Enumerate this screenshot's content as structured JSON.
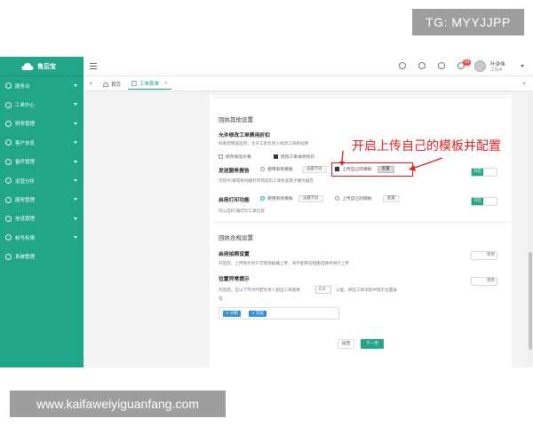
{
  "watermark": {
    "tg": "TG: MYYJJPP",
    "site": "www.kaifaweiyiguanfang.com"
  },
  "app": {
    "brand": "售后宝",
    "nav_items": [
      {
        "label": "服务台",
        "icon": "home-icon"
      },
      {
        "label": "工单中心",
        "icon": "ticket-icon"
      },
      {
        "label": "财务管理",
        "icon": "finance-icon"
      },
      {
        "label": "客户信息",
        "icon": "customer-icon"
      },
      {
        "label": "备件管理",
        "icon": "parts-icon"
      },
      {
        "label": "运营分析",
        "icon": "analytics-icon"
      },
      {
        "label": "服务管理",
        "icon": "service-icon"
      },
      {
        "label": "信息管理",
        "icon": "info-icon"
      },
      {
        "label": "帐号权限",
        "icon": "account-icon"
      },
      {
        "label": "系统管理",
        "icon": "system-icon"
      }
    ]
  },
  "topbar": {
    "badge": "10",
    "user_name": "叶泽伟",
    "user_status": "工作中"
  },
  "tabs": {
    "home": "首页",
    "work_order": "工单套单",
    "close": "×",
    "prev": "«",
    "next": "»"
  },
  "section1": {
    "title": "回执其他设置",
    "allow_discount": {
      "label": "允许修改工单费用折扣",
      "desc": "如果启用该选项，允许工单负责人修改工单折扣费",
      "opt1": "修改单品价格",
      "opt2": "修改工单总折扣价"
    },
    "send_report": {
      "label": "发送服务报告",
      "opt_system": "使用系统模板",
      "btn_set_field": "设置字段",
      "opt_own": "上传自己的模板",
      "btn_config": "配置",
      "desc": "可在PC端或移动端打印完成的工单生成电子服务报告",
      "toggle": "开启"
    },
    "print": {
      "label": "启用打印功能",
      "opt_system": "使用系统模板",
      "btn_set_field": "设置字段",
      "opt_own": "上传自己的模板",
      "btn_config": "配置",
      "desc": "可以在PC端打印工单信息",
      "toggle": "开启"
    }
  },
  "section2": {
    "title": "回执合规设置",
    "photo": {
      "label": "启用拍照设置",
      "desc": "开启后，上传照片时只可现场拍摄上传，将不能够在相册选择并进行上传",
      "toggle": "禁用"
    },
    "location": {
      "label": "位置异常提示",
      "desc_prefix": "开启后，在以下节点时若负责人超出工单距离",
      "value": "0.0",
      "desc_suffix": "公里，将在工单流程中提示位置异",
      "desc_wrap": "常",
      "toggle": "禁用",
      "tags": [
        "× 开始",
        "× 完成"
      ]
    }
  },
  "footer": {
    "back": "返回",
    "next": "下一步"
  },
  "annotation": {
    "text": "开启上传自己的模板并配置"
  },
  "colors": {
    "accent": "#21a68a",
    "annotation": "#e02020",
    "tag": "#2f8fd8"
  }
}
